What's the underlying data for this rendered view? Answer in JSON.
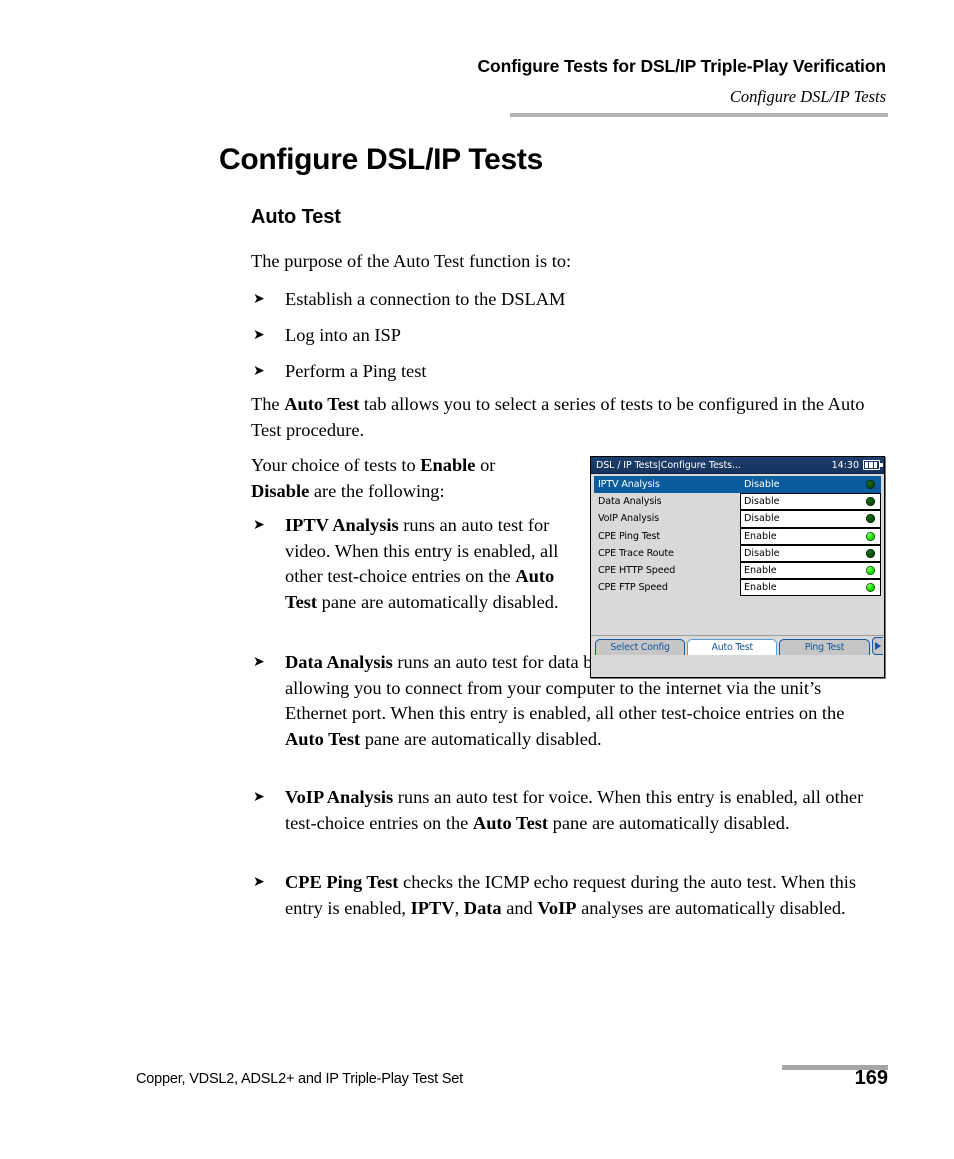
{
  "header": {
    "title": "Configure Tests for DSL/IP Triple-Play Verification",
    "subtitle": "Configure DSL/IP Tests"
  },
  "page": {
    "heading": "Configure DSL/IP Tests",
    "subheading": "Auto Test",
    "intro": "The purpose of the Auto Test function is to:",
    "intro_bullets": [
      "Establish a connection to the DSLAM",
      "Log into an ISP",
      "Perform a Ping test"
    ],
    "para_auto_test": {
      "before": "The ",
      "bold": "Auto Test",
      "after": " tab allows you to select a series of tests to be configured in the Auto Test procedure."
    },
    "para_choice": {
      "p1": "Your choice of tests to ",
      "b1": "Enable",
      "p2": " or",
      "b2": "Disable",
      "p3": " are the following:"
    },
    "test_bullets": [
      {
        "term": "IPTV Analysis",
        "seg1": " runs an auto test for video. When this entry is enabled, all other test-choice entries on the ",
        "term2": "Auto Test",
        "seg2": " pane are automatically disabled."
      },
      {
        "term": "Data Analysis",
        "seg1": " runs an auto test for data by enabling the unit to act as a modem, allowing you to connect from your computer to the internet via the unit’s Ethernet port. When this entry is enabled, all other test-choice entries on the ",
        "term2": "Auto Test",
        "seg2": " pane are automatically disabled."
      },
      {
        "term": "VoIP Analysis",
        "seg1": " runs an auto test for voice. When this entry is enabled, all other test-choice entries on the ",
        "term2": "Auto Test",
        "seg2": " pane are automatically disabled."
      },
      {
        "term": "CPE Ping Test",
        "seg1": " checks the ICMP echo request during the auto test. When this entry is enabled, ",
        "b_iptv": "IPTV",
        "sep1": ", ",
        "b_data": "Data",
        "sep2": " and ",
        "b_voip": "VoIP",
        "seg2": " analyses are automatically disabled."
      }
    ],
    "bullet_glyph": "➤"
  },
  "device": {
    "title": "DSL / IP Tests|Configure Tests...",
    "clock": "14:30",
    "battery_icon": "battery-icon",
    "rows": [
      {
        "label": "IPTV Analysis",
        "value": "Disable",
        "led": "off",
        "selected": true
      },
      {
        "label": "Data Analysis",
        "value": "Disable",
        "led": "off",
        "selected": false
      },
      {
        "label": "VoIP Analysis",
        "value": "Disable",
        "led": "off",
        "selected": false
      },
      {
        "label": "CPE Ping Test",
        "value": "Enable",
        "led": "on",
        "selected": false
      },
      {
        "label": "CPE Trace Route",
        "value": "Disable",
        "led": "off",
        "selected": false
      },
      {
        "label": "CPE HTTP Speed",
        "value": "Enable",
        "led": "on",
        "selected": false
      },
      {
        "label": "CPE FTP Speed",
        "value": "Enable",
        "led": "on",
        "selected": false
      }
    ],
    "tabs": [
      {
        "label": "Select Config",
        "active": false
      },
      {
        "label": "Auto Test",
        "active": true
      },
      {
        "label": "Ping Test",
        "active": false
      }
    ],
    "next_tab_icon": "chevron-right-icon",
    "colors": {
      "titlebar": "#1b3a66",
      "selected_row": "#0a5c9e",
      "tab_text": "#14569b",
      "led_on": "#22e000",
      "led_off": "#0b4a0b"
    }
  },
  "footer": {
    "product": "Copper, VDSL2, ADSL2+ and IP Triple-Play Test Set",
    "page_number": "169"
  }
}
